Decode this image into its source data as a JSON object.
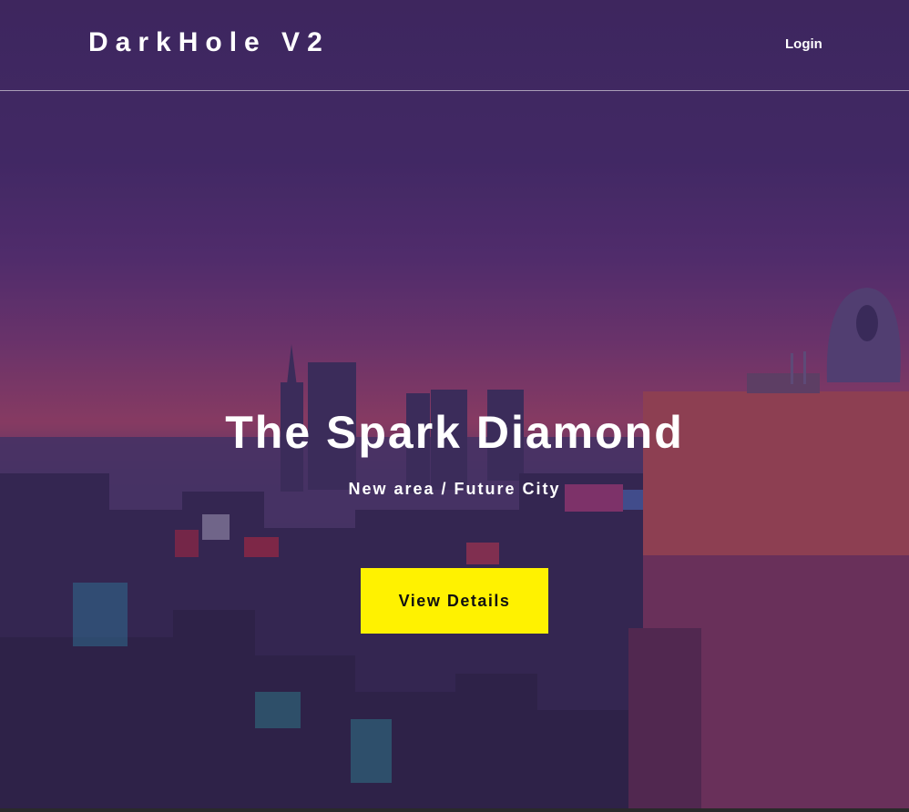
{
  "header": {
    "brand": "DarkHole V2",
    "login_label": "Login"
  },
  "hero": {
    "title": "The Spark Diamond",
    "subtitle": "New area / Future City",
    "cta_label": "View Details"
  },
  "colors": {
    "cta_background": "#fff200",
    "text": "#ffffff",
    "sky_top": "#40295e",
    "sky_horizon": "#a44563"
  }
}
